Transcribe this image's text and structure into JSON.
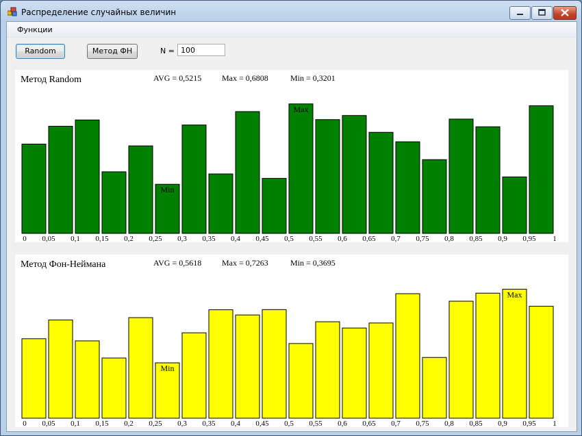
{
  "window": {
    "title": "Распределение случайных величин"
  },
  "menu": {
    "items": [
      "Функции"
    ]
  },
  "toolbar": {
    "random_label": "Random",
    "fn_label": "Метод ФН",
    "n_label": "N =",
    "n_value": "100"
  },
  "charts": [
    {
      "title": "Метод Random",
      "avg": "AVG = 0,5215",
      "max": "Max = 0,6808",
      "min": "Min = 0,3201",
      "color": "#008000",
      "max_label": "Max",
      "min_label": "Min"
    },
    {
      "title": "Метод Фон-Неймана",
      "avg": "AVG = 0,5618",
      "max": "Max = 0,7263",
      "min": "Min = 0,3695",
      "color": "#ffff00",
      "max_label": "Max",
      "min_label": "Min"
    }
  ],
  "chart_data": [
    {
      "type": "bar",
      "title": "Метод Random",
      "tick_labels": [
        "0",
        "0,05",
        "0,1",
        "0,15",
        "0,2",
        "0,25",
        "0,3",
        "0,35",
        "0,4",
        "0,45",
        "0,5",
        "0,55",
        "0,6",
        "0,65",
        "0,7",
        "0,75",
        "0,8",
        "0,85",
        "0,9",
        "0,95",
        "1"
      ],
      "values": [
        0.5,
        0.6,
        0.635,
        0.345,
        0.49,
        0.275,
        0.607,
        0.333,
        0.682,
        0.308,
        0.725,
        0.637,
        0.66,
        0.566,
        0.513,
        0.413,
        0.64,
        0.597,
        0.316,
        0.715
      ],
      "max_index": 10,
      "min_index": 5,
      "color": "#008000"
    },
    {
      "type": "bar",
      "title": "Метод Фон-Неймана",
      "tick_labels": [
        "0",
        "0,05",
        "0,1",
        "0,15",
        "0,2",
        "0,25",
        "0,3",
        "0,35",
        "0,4",
        "0,45",
        "0,5",
        "0,55",
        "0,6",
        "0,65",
        "0,7",
        "0,75",
        "0,8",
        "0,85",
        "0,9",
        "0,95",
        "1"
      ],
      "values": [
        0.445,
        0.55,
        0.433,
        0.337,
        0.563,
        0.31,
        0.478,
        0.607,
        0.578,
        0.608,
        0.418,
        0.54,
        0.505,
        0.533,
        0.697,
        0.34,
        0.655,
        0.7,
        0.722,
        0.627
      ],
      "max_index": 18,
      "min_index": 5,
      "color": "#ffff00"
    }
  ]
}
